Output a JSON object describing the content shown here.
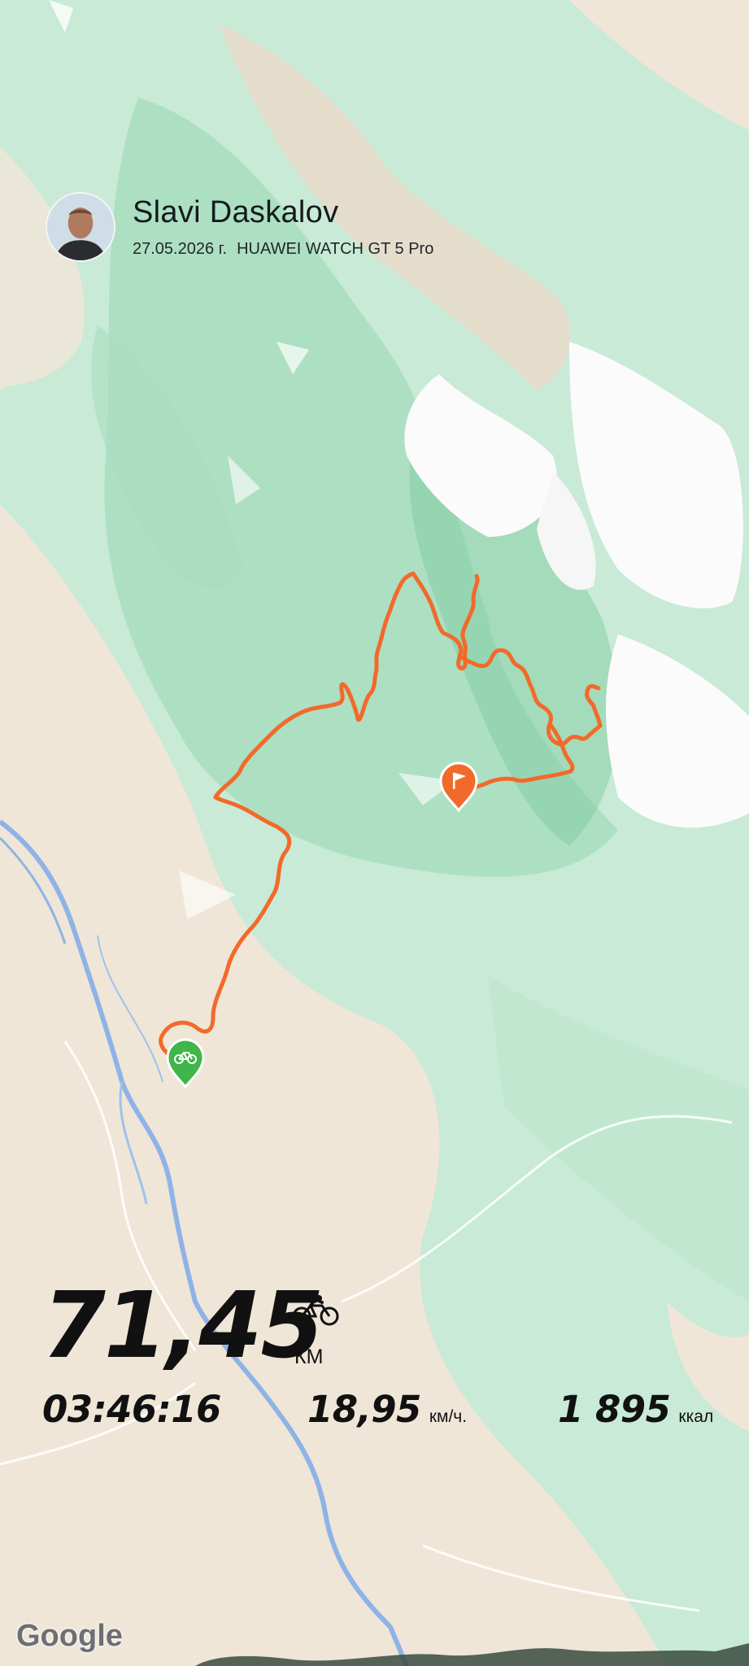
{
  "profile": {
    "name": "Slavi Daskalov",
    "date": "27.05.2026 г.",
    "device": "HUAWEI WATCH GT 5 Pro"
  },
  "stats": {
    "distance": "71,45",
    "distance_unit": "КМ",
    "duration": "03:46:16",
    "speed": "18,95",
    "speed_unit": "км/ч.",
    "calories": "1 895",
    "calories_unit": "ккал"
  },
  "icons": {
    "activity": "bicycle-icon",
    "start_marker": "bicycle-pin-icon",
    "finish_marker": "flag-pin-icon"
  },
  "colors": {
    "route": "#f26a2a",
    "start_pin": "#3fb54a",
    "finish_pin": "#f26a2a"
  },
  "map": {
    "attribution": "Google"
  }
}
